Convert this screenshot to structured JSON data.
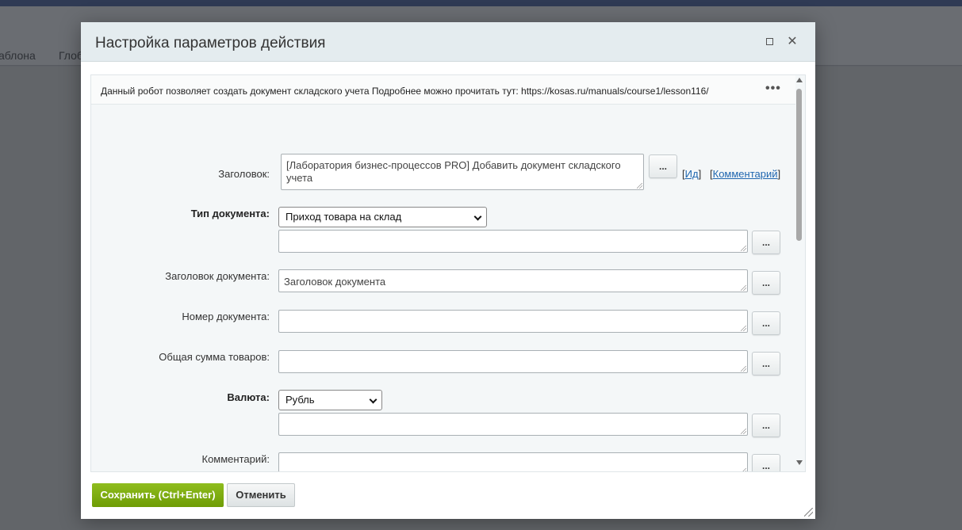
{
  "background": {
    "tabs": [
      "аблона",
      "Глоб"
    ]
  },
  "dialog": {
    "title": "Настройка параметров действия",
    "description": "Данный робот позволяет создать документ складского учета Подробнее можно прочитать тут: https://kosas.ru/manuals/course1/lesson116/",
    "more_label": "•••",
    "dots_label": "...",
    "fields": {
      "title": {
        "label": "Заголовок:",
        "value": "[Лаборатория бизнес-процессов PRO] Добавить документ складского учета",
        "link_id": "Ид",
        "link_comment": "Комментарий"
      },
      "doc_type": {
        "label": "Тип документа:",
        "selected": "Приход товара на склад",
        "value": ""
      },
      "doc_title": {
        "label": "Заголовок документа:",
        "value": "Заголовок документа"
      },
      "doc_number": {
        "label": "Номер документа:",
        "value": ""
      },
      "total": {
        "label": "Общая сумма товаров:",
        "value": ""
      },
      "currency": {
        "label": "Валюта:",
        "selected": "Рубль",
        "value": ""
      },
      "comment": {
        "label": "Комментарий:",
        "value": ""
      }
    },
    "buttons": {
      "save": "Сохранить (Ctrl+Enter)",
      "cancel": "Отменить"
    }
  }
}
